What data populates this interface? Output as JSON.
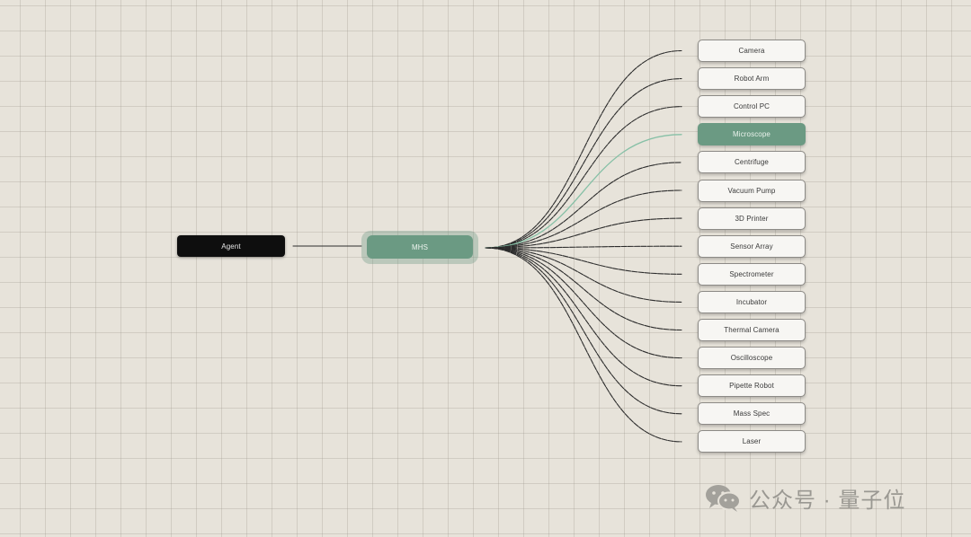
{
  "agent": {
    "label": "Agent"
  },
  "hub": {
    "label": "MHS"
  },
  "devices": [
    {
      "label": "Camera",
      "active": false
    },
    {
      "label": "Robot Arm",
      "active": false
    },
    {
      "label": "Control PC",
      "active": false
    },
    {
      "label": "Microscope",
      "active": true
    },
    {
      "label": "Centrifuge",
      "active": false
    },
    {
      "label": "Vacuum Pump",
      "active": false
    },
    {
      "label": "3D Printer",
      "active": false
    },
    {
      "label": "Sensor Array",
      "active": false
    },
    {
      "label": "Spectrometer",
      "active": false
    },
    {
      "label": "Incubator",
      "active": false
    },
    {
      "label": "Thermal Camera",
      "active": false
    },
    {
      "label": "Oscilloscope",
      "active": false
    },
    {
      "label": "Pipette Robot",
      "active": false
    },
    {
      "label": "Mass Spec",
      "active": false
    },
    {
      "label": "Laser",
      "active": false
    }
  ],
  "colors": {
    "background": "#e7e3da",
    "agent": "#0e0e0e",
    "hub": "#6b9a83",
    "active_wire": "#86c0a6",
    "wire": "#2c2c2c"
  },
  "watermark": {
    "text": "公众号 · 量子位",
    "icon": "wechat-icon"
  }
}
